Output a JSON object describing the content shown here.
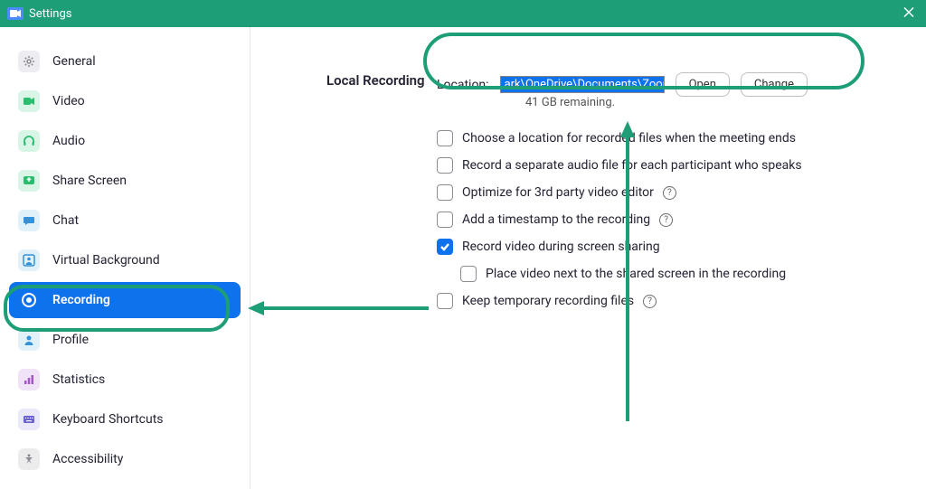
{
  "window": {
    "title": "Settings"
  },
  "sidebar": {
    "items": [
      {
        "label": "General",
        "icon": "general-icon"
      },
      {
        "label": "Video",
        "icon": "video-icon"
      },
      {
        "label": "Audio",
        "icon": "audio-icon"
      },
      {
        "label": "Share Screen",
        "icon": "share-screen-icon"
      },
      {
        "label": "Chat",
        "icon": "chat-icon"
      },
      {
        "label": "Virtual Background",
        "icon": "virtual-background-icon"
      },
      {
        "label": "Recording",
        "icon": "recording-icon",
        "active": true
      },
      {
        "label": "Profile",
        "icon": "profile-icon"
      },
      {
        "label": "Statistics",
        "icon": "statistics-icon"
      },
      {
        "label": "Keyboard Shortcuts",
        "icon": "keyboard-icon"
      },
      {
        "label": "Accessibility",
        "icon": "accessibility-icon"
      }
    ]
  },
  "recording": {
    "section_title": "Local Recording",
    "location_label": "Location:",
    "location_path": "ark\\OneDrive\\Documents\\Zoom",
    "open_btn": "Open",
    "change_btn": "Change",
    "remaining": "41 GB remaining.",
    "options": [
      {
        "label": "Choose a location for recorded files when the meeting ends",
        "checked": false,
        "help": false,
        "indent": false
      },
      {
        "label": "Record a separate audio file for each participant who speaks",
        "checked": false,
        "help": false,
        "indent": false
      },
      {
        "label": "Optimize for 3rd party video editor",
        "checked": false,
        "help": true,
        "indent": false
      },
      {
        "label": "Add a timestamp to the recording",
        "checked": false,
        "help": true,
        "indent": false
      },
      {
        "label": "Record video during screen sharing",
        "checked": true,
        "help": false,
        "indent": false
      },
      {
        "label": "Place video next to the shared screen in the recording",
        "checked": false,
        "help": false,
        "indent": true
      },
      {
        "label": "Keep temporary recording files",
        "checked": false,
        "help": true,
        "indent": false
      }
    ]
  },
  "annotations": {
    "accent": "#1d9e77"
  }
}
